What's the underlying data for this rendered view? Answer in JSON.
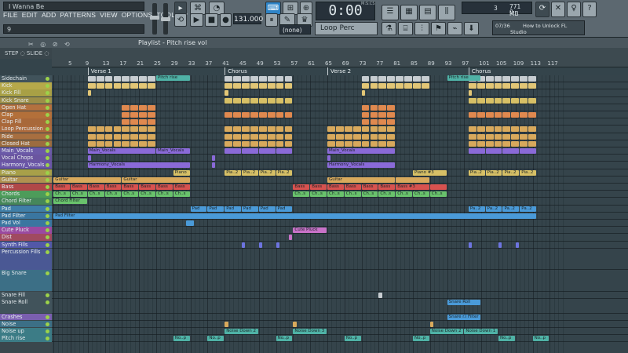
{
  "window": {
    "song_title": "I Wanna Be",
    "hint_text": "9",
    "menu": [
      "FILE",
      "EDIT",
      "ADD",
      "PATTERNS",
      "VIEW",
      "OPTIONS",
      "TOOLS",
      "?"
    ]
  },
  "transport": {
    "tempo": "131.000",
    "time": "0:00",
    "time_unit": "M:S:CS",
    "pattern_selector": "(none)",
    "pattern_name": "Loop Perc"
  },
  "system": {
    "cpu_value": "3",
    "memory": "771 MB",
    "voices": "0"
  },
  "news": {
    "counter": "07/36",
    "line1": "How to Unlock FL",
    "line2": "Studio"
  },
  "playlist": {
    "title": "Playlist - Pitch rise vol",
    "toolbar_glyphs": "✂ ◎ ⊘ ⟲",
    "snap_label": "STEP ◌ SLIDE ◌",
    "bar_numbers": [
      "5",
      "9",
      "13",
      "17",
      "21",
      "25",
      "29",
      "33",
      "37",
      "41",
      "45",
      "49",
      "53",
      "57",
      "61",
      "65",
      "69",
      "73",
      "77",
      "81",
      "85",
      "89",
      "93",
      "97",
      "101",
      "105",
      "109",
      "113",
      "117"
    ],
    "markers": [
      {
        "label": "Verse 1",
        "bar": 9
      },
      {
        "label": "Chorus",
        "bar": 41
      },
      {
        "label": "Verse 2",
        "bar": 65
      },
      {
        "label": "Chorus",
        "bar": 98
      }
    ]
  },
  "colors": {
    "perc": "#d8a95c",
    "kick": "#e2c676",
    "orange": "#e0894f",
    "purple": "#8a6ad8",
    "yellow": "#d7c066",
    "teal": "#4fb2a6",
    "red": "#d8524f",
    "green": "#69c26c",
    "blue": "#4a9ad8",
    "pink": "#c872c8"
  },
  "tracks": [
    {
      "name": "Sidechain",
      "color": "#41535b"
    },
    {
      "name": "Kick",
      "color": "#b6a94a"
    },
    {
      "name": "Kick Fill",
      "color": "#a8a045"
    },
    {
      "name": "Kick Snare",
      "color": "#9d8f48"
    },
    {
      "name": "Open Hat",
      "color": "#b3713f"
    },
    {
      "name": "Clap",
      "color": "#b3703a"
    },
    {
      "name": "Clap Fill",
      "color": "#a8683a"
    },
    {
      "name": "Loop Percussion",
      "color": "#ad6a3c"
    },
    {
      "name": "Ride",
      "color": "#a86f40"
    },
    {
      "name": "Closed Hat",
      "color": "#9c6c3f"
    },
    {
      "name": "Main_Vocals",
      "color": "#6b5aa8"
    },
    {
      "name": "Vocal Chops",
      "color": "#6a55a0"
    },
    {
      "name": "Harmony_Vocals",
      "color": "#6b56a8"
    },
    {
      "name": "Piano",
      "color": "#a8a049"
    },
    {
      "name": "Guitar",
      "color": "#b09150"
    },
    {
      "name": "Bass",
      "color": "#b04848"
    },
    {
      "name": "Chords",
      "color": "#4d9c5a"
    },
    {
      "name": "Chord Filter",
      "color": "#46875a"
    },
    {
      "name": "Pad",
      "color": "#3f7fa8"
    },
    {
      "name": "Pad Filter",
      "color": "#3a76a0"
    },
    {
      "name": "Pad Vol",
      "color": "#3a76a0"
    },
    {
      "name": "Cute Pluck",
      "color": "#9a4aa0"
    },
    {
      "name": "Dist",
      "color": "#a04a60"
    },
    {
      "name": "Synth Fills",
      "color": "#5258a8"
    },
    {
      "name": "Percussion Fills",
      "color": "#4a5894",
      "height": 3
    },
    {
      "name": "Big Snare",
      "color": "#3c6f86",
      "height": 3
    },
    {
      "name": "Snare Fill",
      "color": "#41535b"
    },
    {
      "name": "Snare Roll",
      "color": "#41535b",
      "height": 2
    },
    {
      "name": "Crashes",
      "color": "#7a5fb0"
    },
    {
      "name": "Noise",
      "color": "#3c6f86"
    },
    {
      "name": "Noise up",
      "color": "#3c7c86"
    },
    {
      "name": "Pitch rise",
      "color": "#3c7c86"
    }
  ],
  "clips": [
    {
      "row": 1,
      "start": 9,
      "end": 25,
      "label": "",
      "color": "#e2c676",
      "split": 8
    },
    {
      "row": 1,
      "start": 41,
      "end": 57,
      "label": "",
      "color": "#e2c676",
      "split": 8
    },
    {
      "row": 1,
      "start": 73,
      "end": 89,
      "label": "",
      "color": "#e2c676",
      "split": 8
    },
    {
      "row": 1,
      "start": 98,
      "end": 114,
      "label": "",
      "color": "#e2c676",
      "split": 8
    },
    {
      "row": 0,
      "start": 9,
      "end": 25,
      "label": "",
      "color": "#c7cdd1",
      "split": 8
    },
    {
      "row": 0,
      "start": 41,
      "end": 57,
      "label": "",
      "color": "#c7cdd1",
      "split": 8
    },
    {
      "row": 0,
      "start": 73,
      "end": 89,
      "label": "",
      "color": "#c7cdd1",
      "split": 8
    },
    {
      "row": 0,
      "start": 98,
      "end": 114,
      "label": "",
      "color": "#c7cdd1",
      "split": 8
    },
    {
      "row": 2,
      "start": 9,
      "end": 10,
      "label": "",
      "color": "#e2c676"
    },
    {
      "row": 2,
      "start": 41,
      "end": 42,
      "label": "",
      "color": "#e2c676"
    },
    {
      "row": 2,
      "start": 73,
      "end": 74,
      "label": "",
      "color": "#e2c676"
    },
    {
      "row": 2,
      "start": 98,
      "end": 99,
      "label": "",
      "color": "#e2c676"
    },
    {
      "row": 3,
      "start": 41,
      "end": 57,
      "label": "",
      "color": "#d7c066",
      "split": 8
    },
    {
      "row": 3,
      "start": 98,
      "end": 114,
      "label": "",
      "color": "#d7c066",
      "split": 8
    },
    {
      "row": 4,
      "start": 17,
      "end": 25,
      "label": "",
      "color": "#e0894f",
      "split": 4
    },
    {
      "row": 4,
      "start": 73,
      "end": 81,
      "label": "",
      "color": "#e0894f",
      "split": 4
    },
    {
      "row": 5,
      "start": 17,
      "end": 25,
      "label": "",
      "color": "#e0894f",
      "split": 4
    },
    {
      "row": 5,
      "start": 41,
      "end": 57,
      "label": "",
      "color": "#e0894f",
      "split": 8
    },
    {
      "row": 5,
      "start": 73,
      "end": 81,
      "label": "",
      "color": "#e0894f",
      "split": 4
    },
    {
      "row": 5,
      "start": 98,
      "end": 114,
      "label": "",
      "color": "#e0894f",
      "split": 8
    },
    {
      "row": 6,
      "start": 17,
      "end": 25,
      "label": "",
      "color": "#e0894f",
      "split": 4
    },
    {
      "row": 6,
      "start": 73,
      "end": 81,
      "label": "",
      "color": "#e0894f",
      "split": 4
    },
    {
      "row": 7,
      "start": 9,
      "end": 25,
      "label": "",
      "color": "#d8a95c",
      "split": 8
    },
    {
      "row": 7,
      "start": 41,
      "end": 57,
      "label": "",
      "color": "#d8a95c",
      "split": 8
    },
    {
      "row": 7,
      "start": 65,
      "end": 81,
      "label": "",
      "color": "#d8a95c",
      "split": 8
    },
    {
      "row": 7,
      "start": 98,
      "end": 114,
      "label": "",
      "color": "#d8a95c",
      "split": 8
    },
    {
      "row": 8,
      "start": 9,
      "end": 25,
      "label": "",
      "color": "#d8a95c",
      "split": 8
    },
    {
      "row": 8,
      "start": 41,
      "end": 57,
      "label": "",
      "color": "#d8a95c",
      "split": 8
    },
    {
      "row": 8,
      "start": 65,
      "end": 81,
      "label": "",
      "color": "#d8a95c",
      "split": 8
    },
    {
      "row": 8,
      "start": 98,
      "end": 114,
      "label": "",
      "color": "#d8a95c",
      "split": 8
    },
    {
      "row": 9,
      "start": 9,
      "end": 25,
      "label": "",
      "color": "#d8a95c",
      "split": 8
    },
    {
      "row": 9,
      "start": 41,
      "end": 57,
      "label": "",
      "color": "#d8a95c",
      "split": 8
    },
    {
      "row": 9,
      "start": 65,
      "end": 81,
      "label": "",
      "color": "#d8a95c",
      "split": 8
    },
    {
      "row": 9,
      "start": 98,
      "end": 114,
      "label": "",
      "color": "#d8a95c",
      "split": 8
    },
    {
      "row": 10,
      "start": 9,
      "end": 25,
      "label": "Main_Vocals",
      "color": "#8a6ad8"
    },
    {
      "row": 10,
      "start": 25,
      "end": 33,
      "label": "Main_Vocals",
      "color": "#8a6ad8"
    },
    {
      "row": 10,
      "start": 41,
      "end": 57,
      "label": "",
      "color": "#8a6ad8",
      "split": 4
    },
    {
      "row": 10,
      "start": 65,
      "end": 81,
      "label": "Main_Vocals",
      "color": "#8a6ad8"
    },
    {
      "row": 10,
      "start": 98,
      "end": 114,
      "label": "",
      "color": "#8a6ad8",
      "split": 4
    },
    {
      "row": 11,
      "start": 9,
      "end": 10,
      "label": "",
      "color": "#8a6ad8"
    },
    {
      "row": 11,
      "start": 38,
      "end": 39,
      "label": "",
      "color": "#8a6ad8"
    },
    {
      "row": 11,
      "start": 65,
      "end": 66,
      "label": "",
      "color": "#8a6ad8"
    },
    {
      "row": 12,
      "start": 9,
      "end": 33,
      "label": "Harmony_Vocals",
      "color": "#8a6ad8"
    },
    {
      "row": 12,
      "start": 38,
      "end": 39,
      "label": "",
      "color": "#8a6ad8"
    },
    {
      "row": 12,
      "start": 65,
      "end": 81,
      "label": "Harmony_Vocals",
      "color": "#8a6ad8"
    },
    {
      "row": 13,
      "start": 29,
      "end": 33,
      "label": "Piano",
      "color": "#d7c066"
    },
    {
      "row": 13,
      "start": 41,
      "end": 57,
      "label": "Pia..2",
      "color": "#d7c066",
      "split": 4
    },
    {
      "row": 13,
      "start": 85,
      "end": 93,
      "label": "Piano #3",
      "color": "#d7c066"
    },
    {
      "row": 13,
      "start": 98,
      "end": 114,
      "label": "Pia..2",
      "color": "#d7c066",
      "split": 4
    },
    {
      "row": 14,
      "start": 1,
      "end": 17,
      "label": "Guitar",
      "color": "#d8a95c"
    },
    {
      "row": 14,
      "start": 17,
      "end": 33,
      "label": "Guitar",
      "color": "#d8a95c"
    },
    {
      "row": 14,
      "start": 65,
      "end": 81,
      "label": "Guitar",
      "color": "#d8a95c"
    },
    {
      "row": 14,
      "start": 81,
      "end": 89,
      "label": "",
      "color": "#d8a95c"
    },
    {
      "row": 15,
      "start": 1,
      "end": 33,
      "label": "Bass",
      "color": "#d8524f",
      "split": 8
    },
    {
      "row": 15,
      "start": 57,
      "end": 81,
      "label": "Bass",
      "color": "#d8524f",
      "split": 6
    },
    {
      "row": 15,
      "start": 81,
      "end": 89,
      "label": "Bass #3",
      "color": "#d8524f"
    },
    {
      "row": 15,
      "start": 89,
      "end": 93,
      "label": "",
      "color": "#d8524f"
    },
    {
      "row": 16,
      "start": 1,
      "end": 33,
      "label": "Ch..s",
      "color": "#69c26c",
      "split": 8
    },
    {
      "row": 16,
      "start": 57,
      "end": 93,
      "label": "Ch..s",
      "color": "#69c26c",
      "split": 9
    },
    {
      "row": 17,
      "start": 1,
      "end": 9,
      "label": "Chord Filter",
      "color": "#69c26c"
    },
    {
      "row": 18,
      "start": 33,
      "end": 57,
      "label": "Pad",
      "color": "#4a9ad8",
      "split": 6
    },
    {
      "row": 18,
      "start": 98,
      "end": 114,
      "label": "Pa..2",
      "color": "#4a9ad8",
      "split": 4
    },
    {
      "row": 19,
      "start": 1,
      "end": 114,
      "label": "Pad Filter",
      "color": "#4a9ad8"
    },
    {
      "row": 20,
      "start": 32,
      "end": 34,
      "label": "",
      "color": "#4a9ad8"
    },
    {
      "row": 21,
      "start": 57,
      "end": 65,
      "label": "Cute Pluck",
      "color": "#c872c8"
    },
    {
      "row": 22,
      "start": 56,
      "end": 57,
      "label": "",
      "color": "#c872c8"
    },
    {
      "row": 23,
      "start": 45,
      "end": 46,
      "label": "",
      "color": "#6d74e0"
    },
    {
      "row": 23,
      "start": 49,
      "end": 50,
      "label": "",
      "color": "#6d74e0"
    },
    {
      "row": 23,
      "start": 53,
      "end": 54,
      "label": "",
      "color": "#6d74e0"
    },
    {
      "row": 23,
      "start": 98,
      "end": 99,
      "label": "",
      "color": "#6d74e0"
    },
    {
      "row": 23,
      "start": 105,
      "end": 106,
      "label": "",
      "color": "#6d74e0"
    },
    {
      "row": 23,
      "start": 109,
      "end": 110,
      "label": "",
      "color": "#6d74e0"
    },
    {
      "row": 26,
      "start": 77,
      "end": 78,
      "label": "",
      "color": "#c7cdd1"
    },
    {
      "row": 27,
      "start": 93,
      "end": 101,
      "label": "Snare Roll",
      "color": "#4a9ad8"
    },
    {
      "row": 28,
      "start": 93,
      "end": 101,
      "label": "Snare r.l Filter",
      "color": "#4a9ad8"
    },
    {
      "row": 29,
      "start": 41,
      "end": 42,
      "label": "",
      "color": "#d8a95c"
    },
    {
      "row": 29,
      "start": 57,
      "end": 58,
      "label": "",
      "color": "#d8a95c"
    },
    {
      "row": 29,
      "start": 89,
      "end": 90,
      "label": "",
      "color": "#d8a95c"
    },
    {
      "row": 30,
      "start": 41,
      "end": 49,
      "label": "Noise Down 2",
      "color": "#4fb2a6"
    },
    {
      "row": 30,
      "start": 57,
      "end": 65,
      "label": "Noise Down 3",
      "color": "#4fb2a6"
    },
    {
      "row": 30,
      "start": 89,
      "end": 97,
      "label": "Noise Down 2",
      "color": "#4fb2a6"
    },
    {
      "row": 30,
      "start": 97,
      "end": 105,
      "label": "Noise Down 1",
      "color": "#4fb2a6"
    },
    {
      "row": 31,
      "start": 29,
      "end": 33,
      "label": "No..p",
      "color": "#4fb2a6"
    },
    {
      "row": 31,
      "start": 37,
      "end": 41,
      "label": "No..p",
      "color": "#4fb2a6"
    },
    {
      "row": 31,
      "start": 53,
      "end": 57,
      "label": "No..p",
      "color": "#4fb2a6"
    },
    {
      "row": 31,
      "start": 69,
      "end": 73,
      "label": "No..p",
      "color": "#4fb2a6"
    },
    {
      "row": 31,
      "start": 85,
      "end": 89,
      "label": "No..p",
      "color": "#4fb2a6"
    },
    {
      "row": 31,
      "start": 105,
      "end": 109,
      "label": "No..p",
      "color": "#4fb2a6"
    },
    {
      "row": 31,
      "start": 113,
      "end": 117,
      "label": "No..p",
      "color": "#4fb2a6"
    },
    {
      "row": 32,
      "start": 25,
      "end": 33,
      "label": "Pitch rise",
      "color": "#4fb2a6"
    },
    {
      "row": 32,
      "start": 93,
      "end": 101,
      "label": "Pitch rise",
      "color": "#4fb2a6"
    }
  ]
}
